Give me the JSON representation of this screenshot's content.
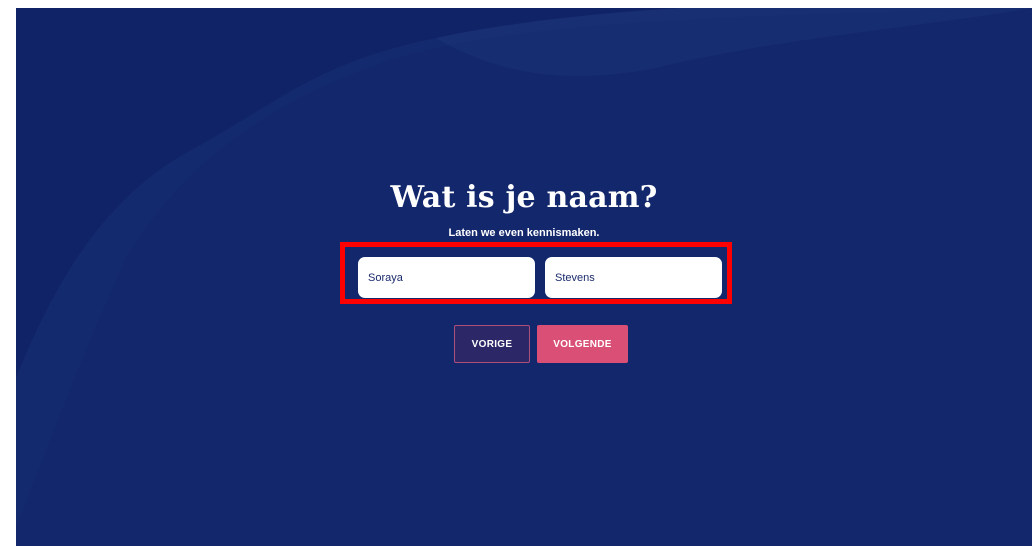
{
  "page": {
    "title": "Wat is je naam?",
    "subtitle": "Laten we even kennismaken."
  },
  "form": {
    "first_name_value": "Soraya",
    "last_name_value": "Stevens"
  },
  "buttons": {
    "prev_label": "VORIGE",
    "next_label": "VOLGENDE"
  },
  "colors": {
    "background": "#102366",
    "accent": "#d94f75",
    "secondary_button": "#2c2766",
    "highlight": "#ff0000"
  }
}
